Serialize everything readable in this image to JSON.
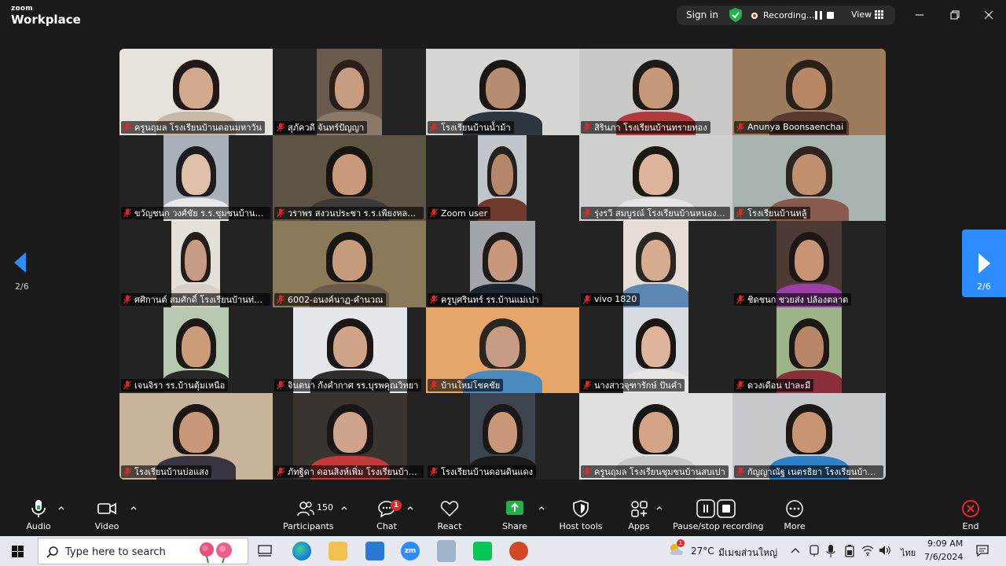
{
  "app": {
    "brand_small": "zoom",
    "brand_large": "Workplace"
  },
  "topbar": {
    "signin_label": "Sign in",
    "recording_label": "Recording...",
    "view_label": "View"
  },
  "gallery": {
    "page_left": "2/6",
    "page_right": "2/6",
    "participants": [
      {
        "name": "ครูนฤมล โรงเรียนบ้านดอนมหาวัน"
      },
      {
        "name": "สุภัควดี จันทร์ปัญญา"
      },
      {
        "name": "โรงเรียนบ้านน้ำม้า"
      },
      {
        "name": "สิรินภา  โรงเรียนบ้านทรายทอง"
      },
      {
        "name": "Anunya  Boonsaenchai"
      },
      {
        "name": "ขวัญชนก วงศ์ชัย ร.ร.ชุมชนบ้านศรี..."
      },
      {
        "name": "วราพร สงวนประชา ร.ร.เพียงหลวง1..."
      },
      {
        "name": "Zoom user"
      },
      {
        "name": "รุ่งรวี สมบูรณ์ โรงเรียนบ้านหนองบัว..."
      },
      {
        "name": "โรงเรียนบ้านหลู้"
      },
      {
        "name": "ศศิกานต์ สมศักดิ์  โรงเรียนบ้านท่าข้..."
      },
      {
        "name": "6002-อนงค์นาฏ-คำนวณ"
      },
      {
        "name": "ครูบุศรินทร์ รร.บ้านแม่เปา"
      },
      {
        "name": "vivo 1820"
      },
      {
        "name": "ชิดชนก ชวยส่ง ปล้องตลาด"
      },
      {
        "name": "เจนจิรา รร.บ้านตุ้มเหนือ"
      },
      {
        "name": "จินตนา กังคำกาศ รร.บุรพคุณวิทยา"
      },
      {
        "name": "บ้านใหม่โชคชัย"
      },
      {
        "name": "นางสาวจุฑารักษ์  ปันคำ"
      },
      {
        "name": "ดวงเดือน ปาละมี"
      },
      {
        "name": "โรงเรียนบ้านบ่อแสง"
      },
      {
        "name": "ภัทฐิดา ดอนสิงห์เพิ่ม โรงเรียนบ้านเกี๋..."
      },
      {
        "name": "โรงเรียนบ้านดอนดินแดง"
      },
      {
        "name": "ครูนฤมล  โรงเรียนชุมชนบ้านสบเปา"
      },
      {
        "name": "กัญญาณัฐ เนตรธิยา โรงเรียนบ้าน..."
      }
    ]
  },
  "toolbar": {
    "audio": "Audio",
    "video": "Video",
    "participants": "Participants",
    "participants_count": "150",
    "chat": "Chat",
    "chat_badge": "1",
    "react": "React",
    "share": "Share",
    "host_tools": "Host tools",
    "apps": "Apps",
    "pause_stop": "Pause/stop recording",
    "more": "More",
    "end": "End"
  },
  "taskbar": {
    "search_placeholder": "Type here to search",
    "weather_temp": "27°C",
    "weather_text": "มีเมฆส่วนใหญ่",
    "lang": "ไทย",
    "time": "9:09 AM",
    "date": "7/6/2024",
    "weather_badge": "1"
  },
  "colors": {
    "accent": "#2d8cff",
    "record_red": "#e02828",
    "share_green": "#23b14d",
    "shield_green": "#23b14d"
  }
}
